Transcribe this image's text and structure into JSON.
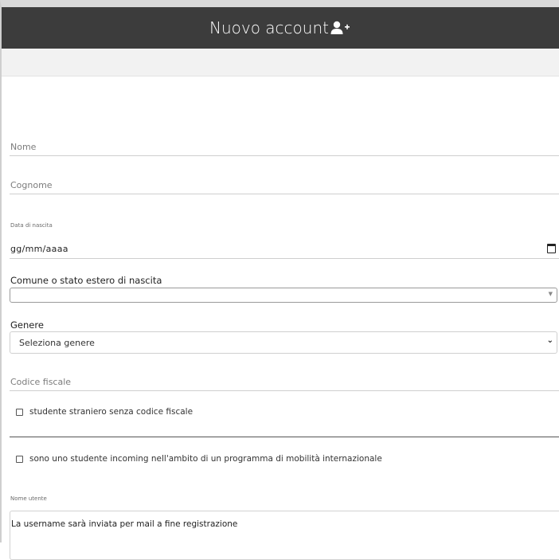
{
  "header": {
    "title": "Nuovo account",
    "icon": "user-plus-icon"
  },
  "form": {
    "nome_placeholder": "Nome",
    "cognome_placeholder": "Cognome",
    "data_nascita_label": "Data di nascita",
    "data_nascita_value": "gg/mm/aaaa",
    "comune_label": "Comune o stato estero di nascita",
    "comune_value": "",
    "genere_label": "Genere",
    "genere_value": "Seleziona genere",
    "codice_fiscale_placeholder": "Codice fiscale",
    "checkbox_straniero": "studente straniero senza codice fiscale",
    "checkbox_incoming": "sono uno studente incoming nell'ambito di un programma di mobilità internazionale",
    "nome_utente_label": "Nome utente",
    "nome_utente_value": "La username sarà inviata per mail a fine registrazione"
  },
  "colors": {
    "header_bg": "#3c3c3c",
    "subbar_bg": "#f2f2f2"
  }
}
